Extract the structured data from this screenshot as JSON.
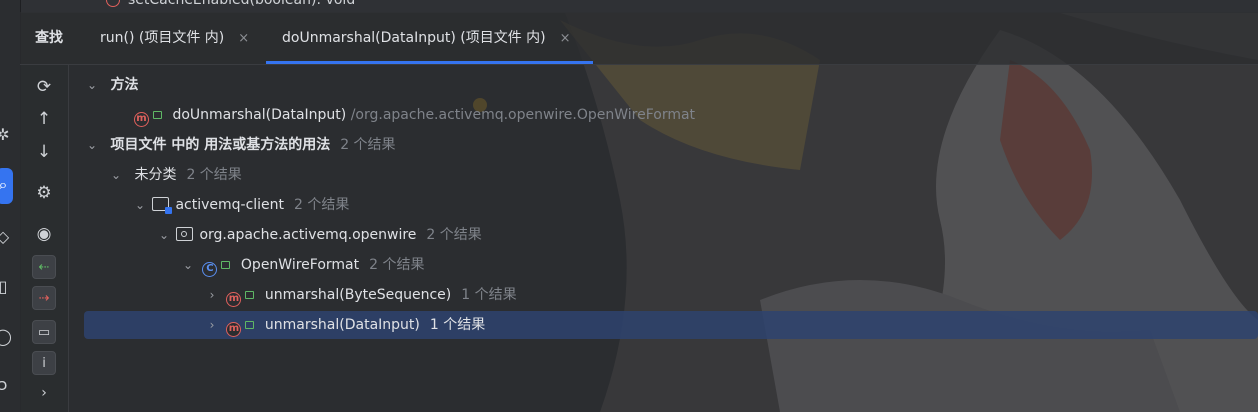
{
  "top_strip": {
    "text": "setCacheEnabled(boolean): void"
  },
  "tabs": {
    "find_label": "查找",
    "items": [
      {
        "label": "run() (项目文件 内)",
        "close": "×"
      },
      {
        "label": "doUnmarshal(DataInput) (项目文件 内)",
        "close": "×"
      }
    ]
  },
  "toolbar": {
    "icons": [
      "refresh-icon",
      "arrow-up-icon",
      "arrow-down-icon",
      "settings-icon",
      "eye-icon",
      "import-icon",
      "export-icon",
      "folder-icon",
      "info-icon",
      "chevron-right-icon"
    ],
    "info_glyph": "i"
  },
  "tree": {
    "method_header": "方法",
    "method_name": "doUnmarshal(DataInput)",
    "method_path": "/org.apache.activemq.openwire.OpenWireFormat",
    "usages_header": "项目文件 中的 用法或基方法的用法",
    "usages_count": "2 个结果",
    "uncategorized": "未分类",
    "uncategorized_count": "2 个结果",
    "module": "activemq-client",
    "module_count": "2 个结果",
    "package": "org.apache.activemq.openwire",
    "package_count": "2 个结果",
    "class_name": "OpenWireFormat",
    "class_count": "2 个结果",
    "class_glyph": "C",
    "method_glyph": "m",
    "results": [
      {
        "name": "unmarshal(ByteSequence)",
        "count": "1 个结果"
      },
      {
        "name": "unmarshal(DataInput)",
        "count": "1 个结果"
      }
    ]
  },
  "colors": {
    "accent": "#3574f0",
    "method": "#e0605c",
    "selection": "#2e436e"
  }
}
